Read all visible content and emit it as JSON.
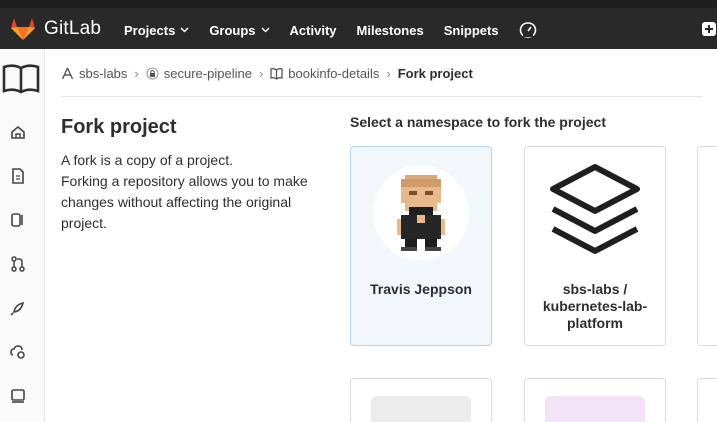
{
  "header": {
    "brand": "GitLab",
    "nav": [
      {
        "label": "Projects",
        "dropdown": true
      },
      {
        "label": "Groups",
        "dropdown": true
      },
      {
        "label": "Activity",
        "dropdown": false
      },
      {
        "label": "Milestones",
        "dropdown": false
      },
      {
        "label": "Snippets",
        "dropdown": false
      }
    ],
    "icons": [
      "gauge-icon",
      "plus-icon"
    ]
  },
  "sidebar": {
    "icons": [
      "project-book-icon",
      "home-icon",
      "document-icon",
      "issues-icon",
      "merge-request-icon",
      "rocket-icon",
      "operations-icon",
      "monitor-icon"
    ]
  },
  "breadcrumb": {
    "items": [
      {
        "label": "sbs-labs",
        "icon": "group-icon"
      },
      {
        "label": "secure-pipeline",
        "icon": "lock-icon"
      },
      {
        "label": "bookinfo-details",
        "icon": "book-icon"
      }
    ],
    "current": "Fork project"
  },
  "main": {
    "title": "Fork project",
    "description": "A fork is a copy of a project.\nForking a repository allows you to make changes without affecting the original project.",
    "namespace_heading": "Select a namespace to fork the project",
    "namespaces": [
      {
        "label": "Travis Jeppson",
        "selected": true,
        "avatar": "pixel-avatar"
      },
      {
        "label": "sbs-labs / kubernetes-lab-platform",
        "selected": false,
        "avatar": "layers-icon"
      }
    ]
  },
  "colors": {
    "navbar": "#292929",
    "brand_orange": "#fc6d26",
    "selected_card_bg": "#f2f7fc",
    "selected_card_border": "#b3d4f2"
  }
}
